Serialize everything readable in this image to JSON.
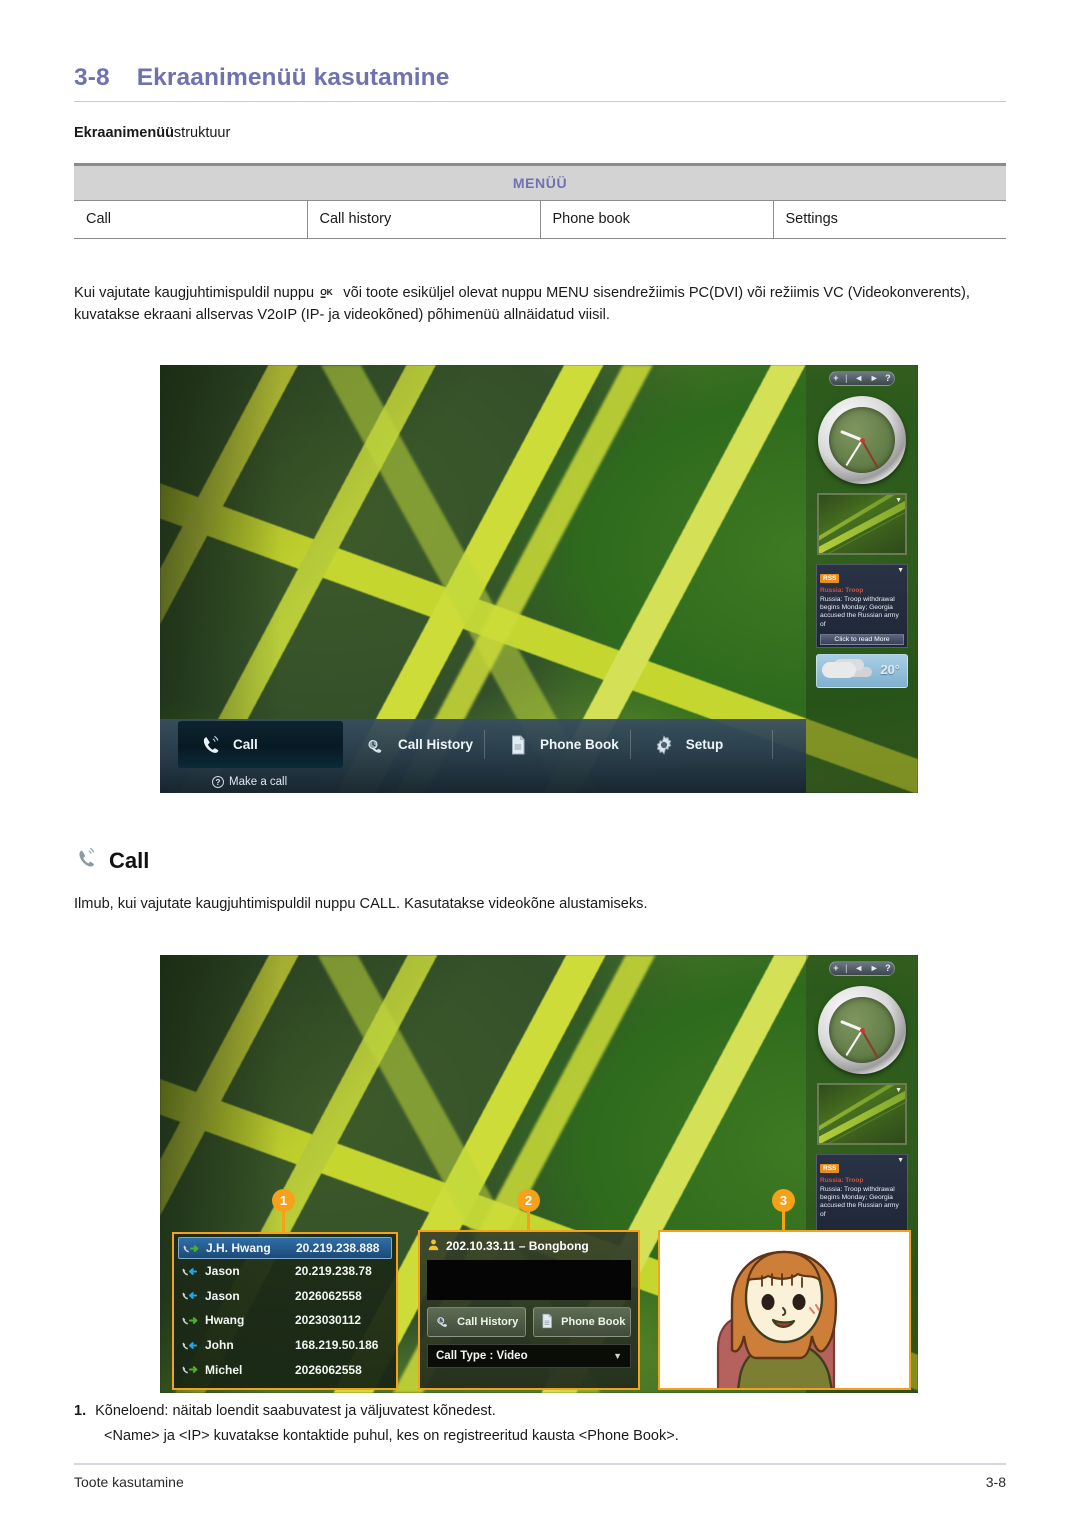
{
  "heading": {
    "number": "3-8",
    "title": "Ekraanimenüü kasutamine"
  },
  "subheading": {
    "bold": "Ekraanimenüü",
    "rest": "struktuur"
  },
  "menu_table": {
    "header": "MENÜÜ",
    "cells": [
      "Call",
      "Call history",
      "Phone book",
      "Settings"
    ]
  },
  "paragraph1": {
    "before_icon": "Kui vajutate kaugjuhtimispuldil nuppu",
    "icon_top": "OK",
    "icon_bottom": "▪▪▪▪",
    "after_icon": "või toote esiküljel olevat nuppu MENU sisendrežiimis PC(DVI) või režiimis VC (Videokonverents), kuvatakse ekraani allservas V2oIP (IP- ja videokõned) põhimenüü allnäidatud viisil."
  },
  "screenshot1": {
    "sidebar": {
      "controls": [
        "+",
        "|",
        "◄",
        "►",
        "?"
      ],
      "rss": {
        "tag": "RSS",
        "title": "Russia: Troop",
        "body": "Russia: Troop withdrawal begins Monday; Georgia accused the Russian army of",
        "more": "Click to read More"
      },
      "weather": {
        "temperature": "20°"
      }
    },
    "menubar": {
      "items": [
        {
          "label": "Call",
          "icon": "phone-icon",
          "active": true
        },
        {
          "label": "Call History",
          "icon": "call-history-icon",
          "active": false
        },
        {
          "label": "Phone Book",
          "icon": "phone-book-icon",
          "active": false
        },
        {
          "label": "Setup",
          "icon": "gear-icon",
          "active": false
        }
      ],
      "hint": "Make a call"
    }
  },
  "call_section": {
    "title": "Call",
    "paragraph": "Ilmub, kui vajutate kaugjuhtimispuldil nuppu CALL. Kasutatakse videokõne alustamiseks."
  },
  "screenshot2": {
    "badges": [
      "1",
      "2",
      "3"
    ],
    "call_list": [
      {
        "name": "J.H. Hwang",
        "number": "20.219.238.888",
        "direction": "outgoing",
        "selected": true
      },
      {
        "name": "Jason",
        "number": "20.219.238.78",
        "direction": "incoming",
        "selected": false
      },
      {
        "name": "Jason",
        "number": "2026062558",
        "direction": "incoming",
        "selected": false
      },
      {
        "name": "Hwang",
        "number": "2023030112",
        "direction": "outgoing",
        "selected": false
      },
      {
        "name": "John",
        "number": "168.219.50.186",
        "direction": "incoming",
        "selected": false
      },
      {
        "name": "Michel",
        "number": "2026062558",
        "direction": "outgoing",
        "selected": false
      }
    ],
    "dial_panel": {
      "contact": "202.10.33.11 – Bongbong",
      "buttons": [
        {
          "label": "Call History",
          "icon": "call-history-icon"
        },
        {
          "label": "Phone Book",
          "icon": "phone-book-icon"
        }
      ],
      "call_type": "Call Type : Video"
    }
  },
  "notes": {
    "number": "1.",
    "line1": "Kõneloend: näitab loendit saabuvatest ja väljuvatest kõnedest.",
    "line2": "<Name> ja <IP> kuvatakse kontaktide puhul, kes on registreeritud kausta <Phone Book>."
  },
  "footer": {
    "left": "Toote kasutamine",
    "right": "3-8"
  },
  "colors": {
    "heading": "#6f72ae",
    "accent_orange": "#f5a11b",
    "table_header_bg": "#d3d3d3",
    "selected_row": "#2f6ea8"
  }
}
